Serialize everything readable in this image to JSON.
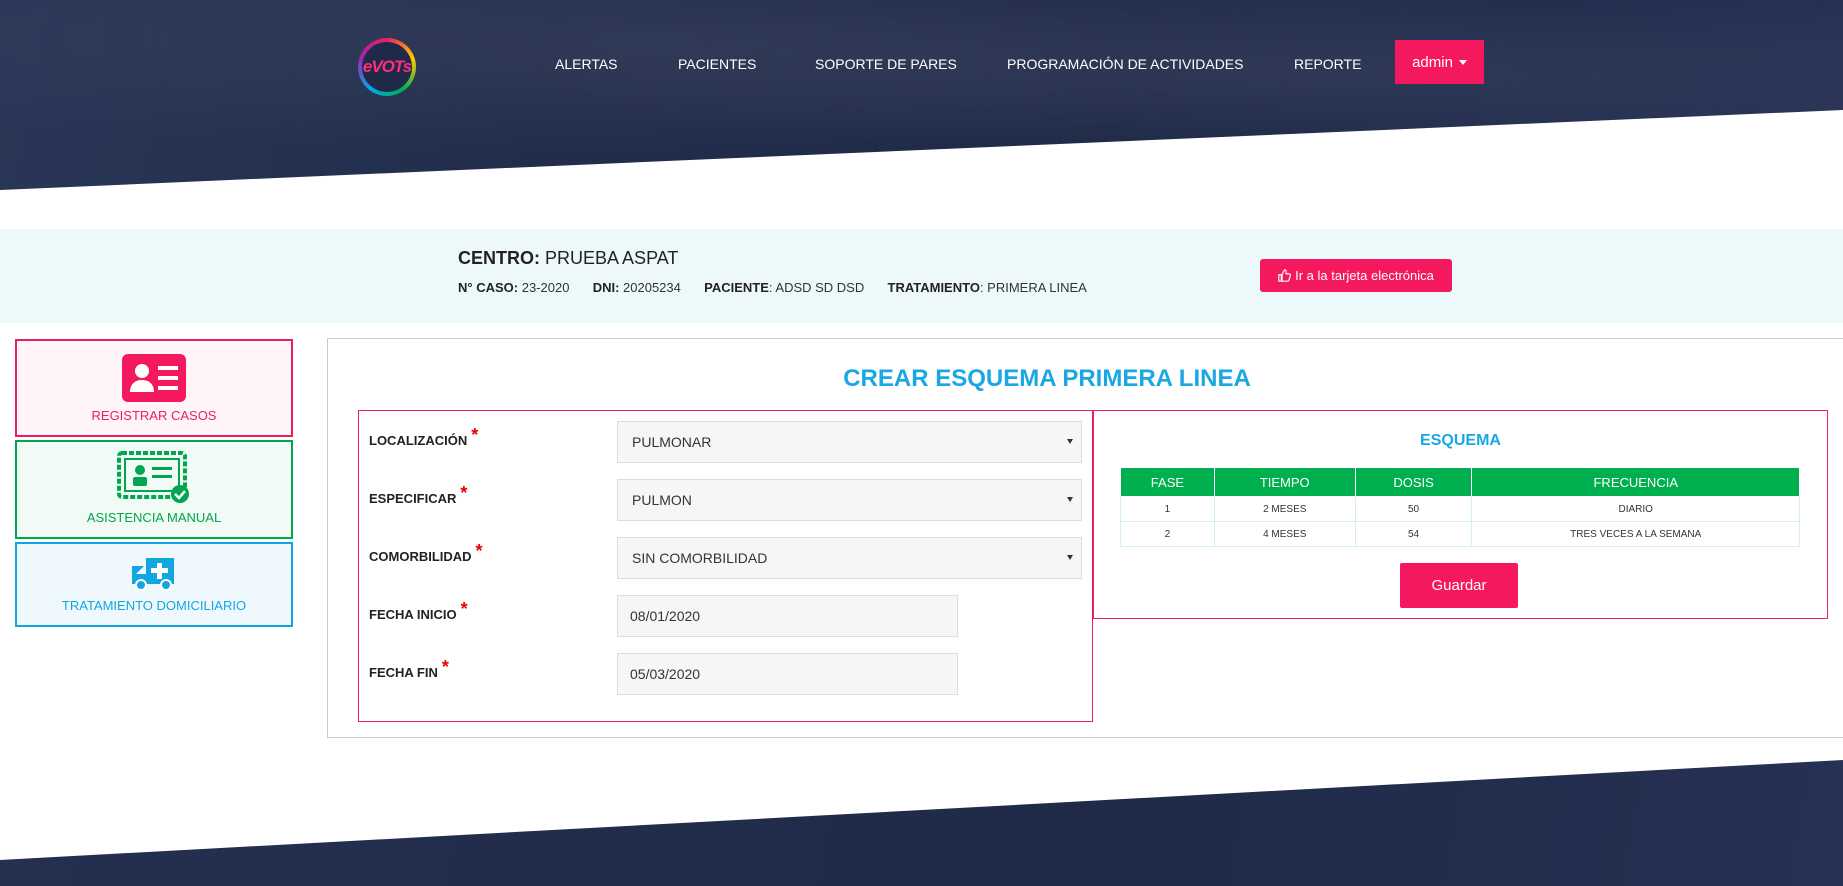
{
  "header": {
    "logo_text": "eVOTs",
    "nav": [
      {
        "label": "ALERTAS"
      },
      {
        "label": "PACIENTES"
      },
      {
        "label": "SOPORTE DE PARES"
      },
      {
        "label": "PROGRAMACIÓN DE ACTIVIDADES"
      },
      {
        "label": "REPORTE"
      }
    ],
    "user_menu": "admin"
  },
  "case_info": {
    "centro_label": "CENTRO:",
    "centro_value": "PRUEBA ASPAT",
    "caso_label": "N° CASO:",
    "caso_value": "23-2020",
    "dni_label": "DNI:",
    "dni_value": "20205234",
    "paciente_label": "PACIENTE",
    "paciente_value": ": ADSD SD DSD",
    "tratamiento_label": "TRATAMIENTO",
    "tratamiento_value": ": PRIMERA LINEA",
    "tarjeta_button": "Ir a la tarjeta electrónica"
  },
  "sidebar": {
    "items": [
      {
        "label": "REGISTRAR CASOS",
        "icon": "id-card-icon",
        "color": "#e91e63"
      },
      {
        "label": "ASISTENCIA MANUAL",
        "icon": "certificate-check-icon",
        "color": "#00a650"
      },
      {
        "label": "TRATAMIENTO DOMICILIARIO",
        "icon": "ambulance-icon",
        "color": "#12a6e0"
      }
    ]
  },
  "main": {
    "title": "CREAR ESQUEMA PRIMERA LINEA",
    "form": {
      "localizacion_label": "LOCALIZACIÓN",
      "localizacion_value": "PULMONAR",
      "especificar_label": "ESPECIFICAR",
      "especificar_value": "PULMON",
      "comorbilidad_label": "COMORBILIDAD",
      "comorbilidad_value": "SIN COMORBILIDAD",
      "fecha_inicio_label": "FECHA INICIO",
      "fecha_inicio_value": "08/01/2020",
      "fecha_fin_label": "FECHA FIN",
      "fecha_fin_value": "05/03/2020",
      "required_mark": "*"
    },
    "esquema": {
      "title": "ESQUEMA",
      "columns": [
        "FASE",
        "TIEMPO",
        "DOSIS",
        "FRECUENCIA"
      ],
      "rows": [
        [
          "1",
          "2 MESES",
          "50",
          "DIARIO"
        ],
        [
          "2",
          "4 MESES",
          "54",
          "TRES VECES A LA SEMANA"
        ]
      ],
      "save_button": "Guardar"
    }
  },
  "colors": {
    "accent_pink": "#f4185f",
    "accent_blue": "#1aa7e4",
    "table_header_green": "#00b04f",
    "header_dark": "#1f2a48"
  }
}
